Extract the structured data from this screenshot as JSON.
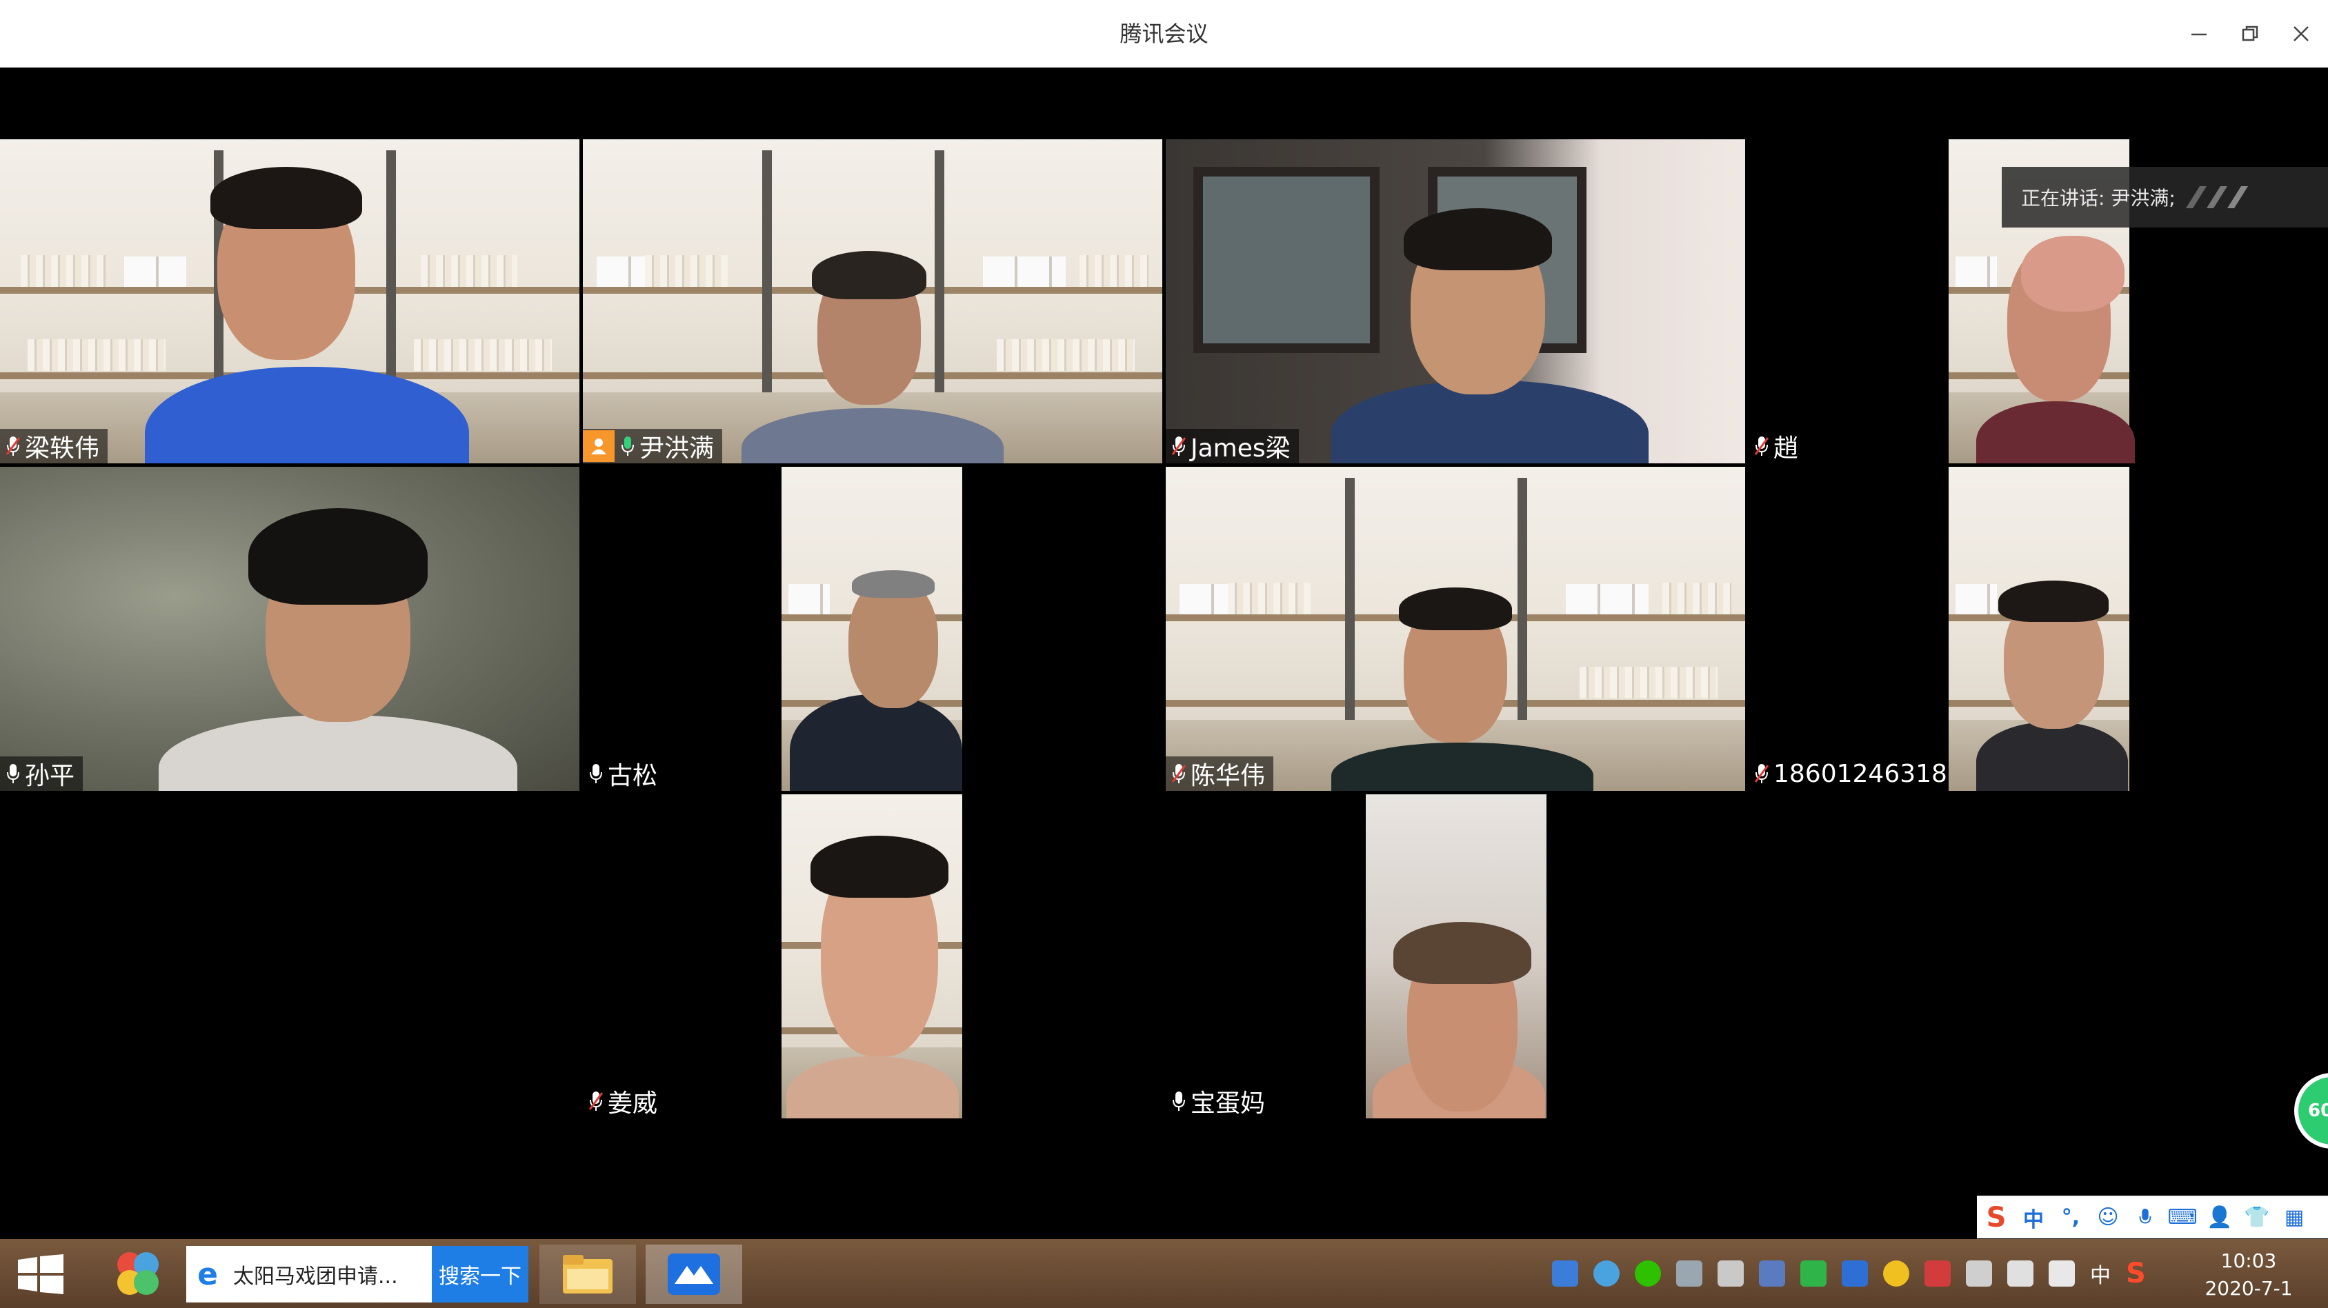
{
  "window": {
    "title": "腾讯会议"
  },
  "speaking": {
    "text": "正在讲话: 尹洪满;"
  },
  "participants": [
    {
      "name": "梁轶伟"
    },
    {
      "name": "尹洪满"
    },
    {
      "name": "James梁"
    },
    {
      "name": "趙"
    },
    {
      "name": "孙平"
    },
    {
      "name": "古松"
    },
    {
      "name": "陈华伟"
    },
    {
      "name": "18601246318"
    },
    {
      "name": "姜威"
    },
    {
      "name": "宝蛋妈"
    }
  ],
  "floating_ball": {
    "text": "60"
  },
  "ime": {
    "mode": "中"
  },
  "taskbar": {
    "search_text": "太阳马戏团申请...",
    "search_button": "搜索一下",
    "tray_lang": "中",
    "clock_time": "10:03",
    "clock_date": "2020-7-1"
  },
  "colors": {
    "active_border": "#16c26a",
    "host_badge": "#f6962b",
    "taskbar": "#6a4c34",
    "search_button": "#1e7ee6"
  }
}
